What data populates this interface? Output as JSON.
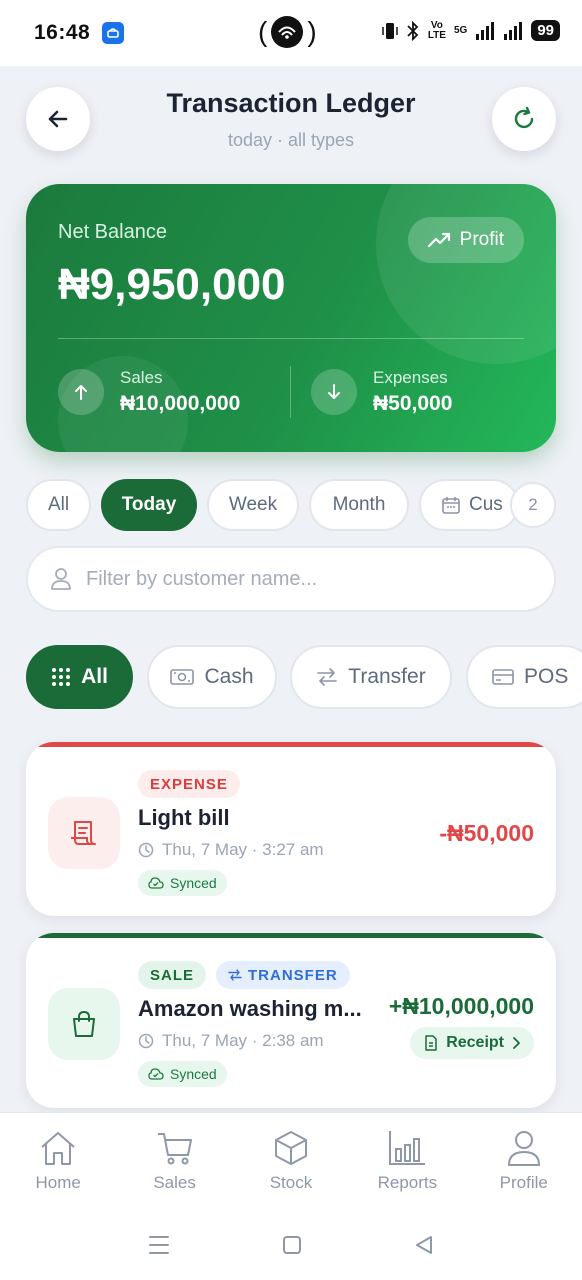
{
  "status_bar": {
    "time": "16:48",
    "hotspot_left": "(",
    "hotspot_right": ")",
    "net_small": "Vo",
    "lte_small": "LTE",
    "fiveg": "5G",
    "battery": "99"
  },
  "header": {
    "title": "Transaction Ledger",
    "subtitle": "today · all types"
  },
  "balance": {
    "label": "Net Balance",
    "value": "₦9,950,000",
    "profit_label": "Profit",
    "sales_label": "Sales",
    "sales_value": "₦10,000,000",
    "expenses_label": "Expenses",
    "expenses_value": "₦50,000"
  },
  "period_filters": {
    "all": "All",
    "today": "Today",
    "week": "Week",
    "month": "Month",
    "custom": "Cus",
    "count": "2"
  },
  "search": {
    "placeholder": "Filter by customer name..."
  },
  "type_filters": {
    "all": "All",
    "cash": "Cash",
    "transfer": "Transfer",
    "pos": "POS"
  },
  "transactions": [
    {
      "tag": "EXPENSE",
      "title": "Light bill",
      "date": "Thu, 7 May · 3:27 am",
      "sync": "Synced",
      "amount": "-₦50,000"
    },
    {
      "tag": "SALE",
      "method": "TRANSFER",
      "title": "Amazon washing m...",
      "date": "Thu, 7 May · 2:38 am",
      "sync": "Synced",
      "amount": "+₦10,000,000",
      "receipt": "Receipt"
    }
  ],
  "nav": {
    "home": "Home",
    "sales": "Sales",
    "stock": "Stock",
    "reports": "Reports",
    "profile": "Profile"
  },
  "colors": {
    "primary": "#1b6b38",
    "expense": "#e04848",
    "income": "#1b6b38",
    "muted": "#9aa5b5"
  }
}
